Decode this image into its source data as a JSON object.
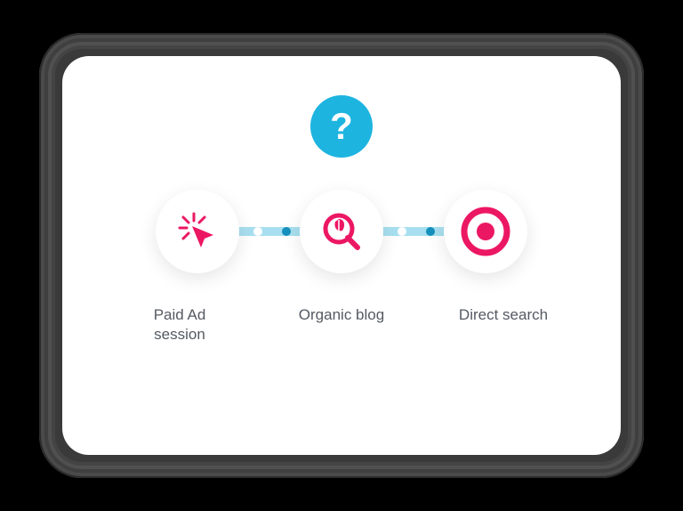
{
  "question_mark": "?",
  "steps": [
    {
      "icon": "click-icon",
      "label": "Paid Ad session"
    },
    {
      "icon": "leaf-search-icon",
      "label": "Organic blog"
    },
    {
      "icon": "target-icon",
      "label": "Direct search"
    }
  ],
  "colors": {
    "accent_pink": "#ec1763",
    "accent_blue": "#1db4e0",
    "connector": "#a8dff0",
    "text": "#545a63"
  }
}
